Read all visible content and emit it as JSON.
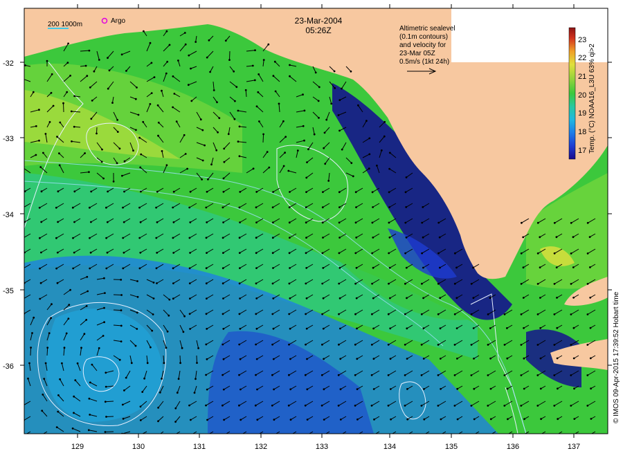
{
  "header": {
    "date": "23-Mar-2004",
    "time": "05:26Z"
  },
  "scale_legend": {
    "label": "200  1000m"
  },
  "argo_legend": {
    "label": "Argo",
    "color": "#e000e0"
  },
  "velocity_note": {
    "line1": "Altimetric sealevel",
    "line2": "(0.1m contours)",
    "line3": "and velocity for",
    "line4": "23-Mar 05Z",
    "line5": "0.5m/s (1kt 24h)"
  },
  "colorbar": {
    "title": "Temp. (°C) NOAA16_L3U 63% qi>2",
    "ticks": [
      "17",
      "18",
      "19",
      "20",
      "21",
      "22",
      "23"
    ],
    "colors": [
      "#1a0a8c",
      "#1e3cd2",
      "#1e7ce8",
      "#20b8e0",
      "#28c8a0",
      "#3cc83c",
      "#8cd23c",
      "#e0e03c",
      "#f0a028",
      "#d2321e",
      "#8c1414"
    ]
  },
  "axes": {
    "x_ticks": [
      "129",
      "130",
      "131",
      "132",
      "133",
      "134",
      "135",
      "136",
      "137"
    ],
    "y_ticks": [
      "-32",
      "-33",
      "-34",
      "-35",
      "-36"
    ]
  },
  "credit": "© IMOS 09-Apr-2015 17:39:52 Hobart time",
  "colors": {
    "land": "#f7c8a0",
    "warm_water": "#3cc83c",
    "cool_water": "#1e7ce8",
    "cold_water": "#14148c",
    "contour": "#e8f0ff",
    "shelf_line": "#a0e0ff"
  }
}
